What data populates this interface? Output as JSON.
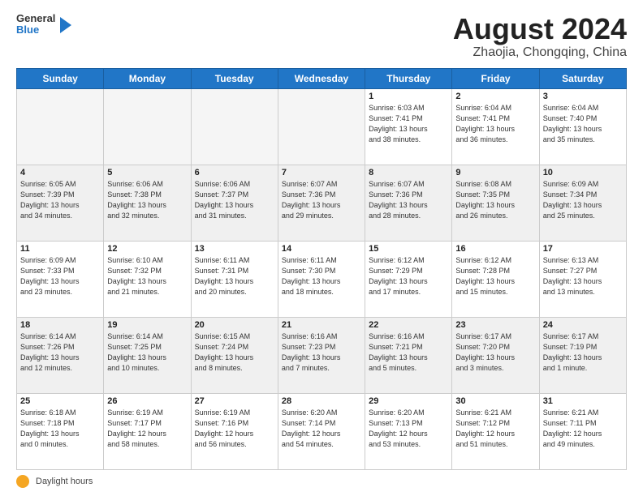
{
  "header": {
    "logo_general": "General",
    "logo_blue": "Blue",
    "month_year": "August 2024",
    "location": "Zhaojia, Chongqing, China"
  },
  "days_of_week": [
    "Sunday",
    "Monday",
    "Tuesday",
    "Wednesday",
    "Thursday",
    "Friday",
    "Saturday"
  ],
  "footer_label": "Daylight hours",
  "weeks": [
    {
      "row_class": "normal",
      "days": [
        {
          "num": "",
          "info": "",
          "empty": true
        },
        {
          "num": "",
          "info": "",
          "empty": true
        },
        {
          "num": "",
          "info": "",
          "empty": true
        },
        {
          "num": "",
          "info": "",
          "empty": true
        },
        {
          "num": "1",
          "info": "Sunrise: 6:03 AM\nSunset: 7:41 PM\nDaylight: 13 hours\nand 38 minutes."
        },
        {
          "num": "2",
          "info": "Sunrise: 6:04 AM\nSunset: 7:41 PM\nDaylight: 13 hours\nand 36 minutes."
        },
        {
          "num": "3",
          "info": "Sunrise: 6:04 AM\nSunset: 7:40 PM\nDaylight: 13 hours\nand 35 minutes."
        }
      ]
    },
    {
      "row_class": "alt",
      "days": [
        {
          "num": "4",
          "info": "Sunrise: 6:05 AM\nSunset: 7:39 PM\nDaylight: 13 hours\nand 34 minutes."
        },
        {
          "num": "5",
          "info": "Sunrise: 6:06 AM\nSunset: 7:38 PM\nDaylight: 13 hours\nand 32 minutes."
        },
        {
          "num": "6",
          "info": "Sunrise: 6:06 AM\nSunset: 7:37 PM\nDaylight: 13 hours\nand 31 minutes."
        },
        {
          "num": "7",
          "info": "Sunrise: 6:07 AM\nSunset: 7:36 PM\nDaylight: 13 hours\nand 29 minutes."
        },
        {
          "num": "8",
          "info": "Sunrise: 6:07 AM\nSunset: 7:36 PM\nDaylight: 13 hours\nand 28 minutes."
        },
        {
          "num": "9",
          "info": "Sunrise: 6:08 AM\nSunset: 7:35 PM\nDaylight: 13 hours\nand 26 minutes."
        },
        {
          "num": "10",
          "info": "Sunrise: 6:09 AM\nSunset: 7:34 PM\nDaylight: 13 hours\nand 25 minutes."
        }
      ]
    },
    {
      "row_class": "normal",
      "days": [
        {
          "num": "11",
          "info": "Sunrise: 6:09 AM\nSunset: 7:33 PM\nDaylight: 13 hours\nand 23 minutes."
        },
        {
          "num": "12",
          "info": "Sunrise: 6:10 AM\nSunset: 7:32 PM\nDaylight: 13 hours\nand 21 minutes."
        },
        {
          "num": "13",
          "info": "Sunrise: 6:11 AM\nSunset: 7:31 PM\nDaylight: 13 hours\nand 20 minutes."
        },
        {
          "num": "14",
          "info": "Sunrise: 6:11 AM\nSunset: 7:30 PM\nDaylight: 13 hours\nand 18 minutes."
        },
        {
          "num": "15",
          "info": "Sunrise: 6:12 AM\nSunset: 7:29 PM\nDaylight: 13 hours\nand 17 minutes."
        },
        {
          "num": "16",
          "info": "Sunrise: 6:12 AM\nSunset: 7:28 PM\nDaylight: 13 hours\nand 15 minutes."
        },
        {
          "num": "17",
          "info": "Sunrise: 6:13 AM\nSunset: 7:27 PM\nDaylight: 13 hours\nand 13 minutes."
        }
      ]
    },
    {
      "row_class": "alt",
      "days": [
        {
          "num": "18",
          "info": "Sunrise: 6:14 AM\nSunset: 7:26 PM\nDaylight: 13 hours\nand 12 minutes."
        },
        {
          "num": "19",
          "info": "Sunrise: 6:14 AM\nSunset: 7:25 PM\nDaylight: 13 hours\nand 10 minutes."
        },
        {
          "num": "20",
          "info": "Sunrise: 6:15 AM\nSunset: 7:24 PM\nDaylight: 13 hours\nand 8 minutes."
        },
        {
          "num": "21",
          "info": "Sunrise: 6:16 AM\nSunset: 7:23 PM\nDaylight: 13 hours\nand 7 minutes."
        },
        {
          "num": "22",
          "info": "Sunrise: 6:16 AM\nSunset: 7:21 PM\nDaylight: 13 hours\nand 5 minutes."
        },
        {
          "num": "23",
          "info": "Sunrise: 6:17 AM\nSunset: 7:20 PM\nDaylight: 13 hours\nand 3 minutes."
        },
        {
          "num": "24",
          "info": "Sunrise: 6:17 AM\nSunset: 7:19 PM\nDaylight: 13 hours\nand 1 minute."
        }
      ]
    },
    {
      "row_class": "normal",
      "days": [
        {
          "num": "25",
          "info": "Sunrise: 6:18 AM\nSunset: 7:18 PM\nDaylight: 13 hours\nand 0 minutes."
        },
        {
          "num": "26",
          "info": "Sunrise: 6:19 AM\nSunset: 7:17 PM\nDaylight: 12 hours\nand 58 minutes."
        },
        {
          "num": "27",
          "info": "Sunrise: 6:19 AM\nSunset: 7:16 PM\nDaylight: 12 hours\nand 56 minutes."
        },
        {
          "num": "28",
          "info": "Sunrise: 6:20 AM\nSunset: 7:14 PM\nDaylight: 12 hours\nand 54 minutes."
        },
        {
          "num": "29",
          "info": "Sunrise: 6:20 AM\nSunset: 7:13 PM\nDaylight: 12 hours\nand 53 minutes."
        },
        {
          "num": "30",
          "info": "Sunrise: 6:21 AM\nSunset: 7:12 PM\nDaylight: 12 hours\nand 51 minutes."
        },
        {
          "num": "31",
          "info": "Sunrise: 6:21 AM\nSunset: 7:11 PM\nDaylight: 12 hours\nand 49 minutes."
        }
      ]
    }
  ]
}
